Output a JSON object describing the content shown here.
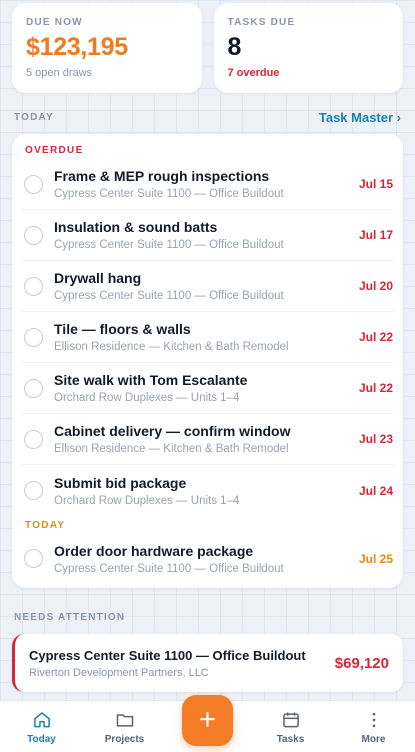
{
  "stats": {
    "due_now": {
      "label": "DUE NOW",
      "value": "$123,195",
      "sub": "5 open draws"
    },
    "tasks_due": {
      "label": "TASKS DUE",
      "value": "8",
      "sub": "7 overdue"
    }
  },
  "today_section": {
    "title": "TODAY",
    "link": "Task Master ›"
  },
  "groups": {
    "overdue": "OVERDUE",
    "today": "TODAY"
  },
  "tasks": [
    {
      "title": "Frame & MEP rough inspections",
      "project": "Cypress Center Suite 1100 — Office Buildout",
      "date": "Jul 15"
    },
    {
      "title": "Insulation & sound batts",
      "project": "Cypress Center Suite 1100 — Office Buildout",
      "date": "Jul 17"
    },
    {
      "title": "Drywall hang",
      "project": "Cypress Center Suite 1100 — Office Buildout",
      "date": "Jul 20"
    },
    {
      "title": "Tile — floors & walls",
      "project": "Ellison Residence — Kitchen & Bath Remodel",
      "date": "Jul 22"
    },
    {
      "title": "Site walk with Tom Escalante",
      "project": "Orchard Row Duplexes — Units 1–4",
      "date": "Jul 22"
    },
    {
      "title": "Cabinet delivery — confirm window",
      "project": "Ellison Residence — Kitchen & Bath Remodel",
      "date": "Jul 23"
    },
    {
      "title": "Submit bid package",
      "project": "Orchard Row Duplexes — Units 1–4",
      "date": "Jul 24"
    },
    {
      "title": "Order door hardware package",
      "project": "Cypress Center Suite 1100 — Office Buildout",
      "date": "Jul 25"
    }
  ],
  "attention": {
    "title": "NEEDS ATTENTION",
    "item": {
      "title": "Cypress Center Suite 1100 — Office Buildout",
      "client": "Riverton Development Partners, LLC",
      "amount": "$69,120"
    }
  },
  "tabbar": {
    "today": "Today",
    "projects": "Projects",
    "add": "+",
    "tasks": "Tasks",
    "more": "More"
  },
  "colors": {
    "accent": "#1a7fb5",
    "orange": "#f07a1c",
    "overdue_red": "#d6263a",
    "today_orange": "#e08a1a"
  },
  "icons": {
    "tab_today": "home-icon",
    "tab_projects": "folder-icon",
    "tab_add": "plus-icon",
    "tab_tasks": "calendar-icon",
    "tab_more": "more-vertical-icon"
  }
}
